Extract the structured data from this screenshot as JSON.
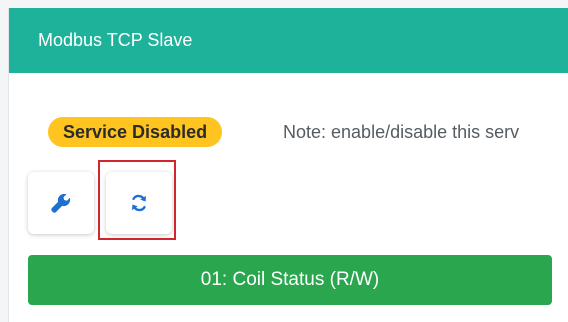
{
  "panel": {
    "title": "Modbus TCP Slave"
  },
  "status": {
    "badge": "Service Disabled",
    "note": "Note: enable/disable this serv"
  },
  "toolbar": {
    "config_icon": "wrench-icon",
    "refresh_icon": "refresh-icon"
  },
  "sections": [
    {
      "label": "01: Coil Status (R/W)"
    }
  ],
  "colors": {
    "header": "#1fb29a",
    "badge": "#ffc41f",
    "accent_icon": "#1f6fd1",
    "section_button": "#2aa64f",
    "highlight": "#d3262c"
  }
}
